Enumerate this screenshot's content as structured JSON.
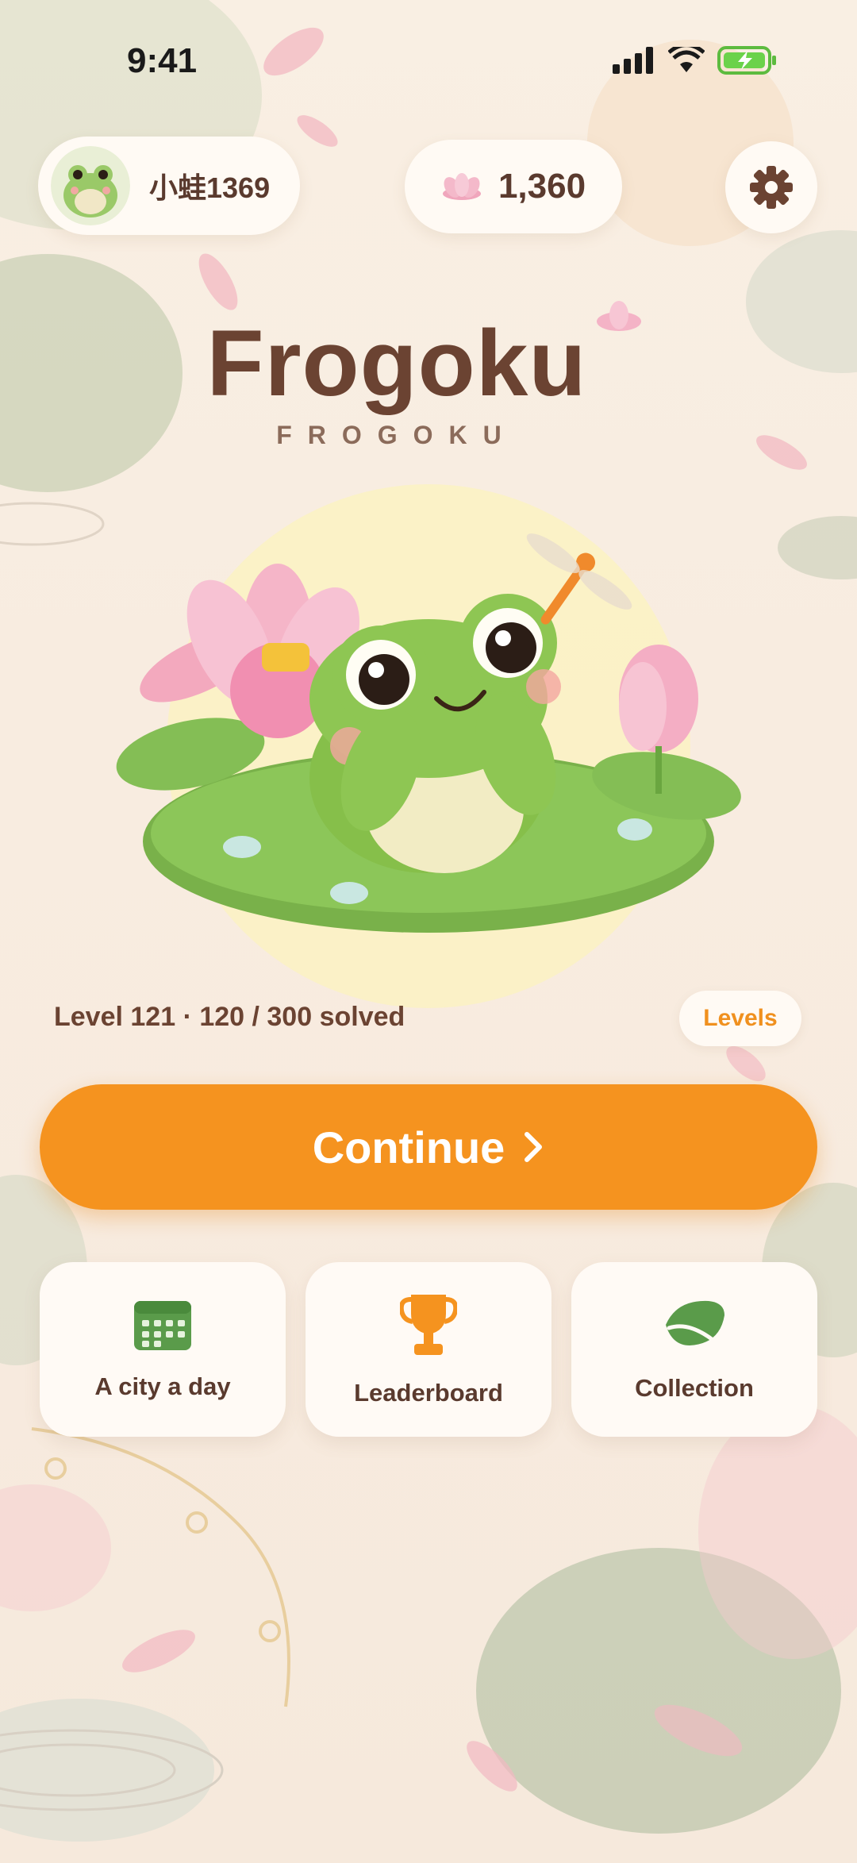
{
  "status_bar": {
    "time": "9:41"
  },
  "profile": {
    "name": "小蛙1369"
  },
  "currency": {
    "value": "1,360",
    "icon": "lotus-icon"
  },
  "settings": {
    "icon": "gear-icon"
  },
  "title": "Frogoku",
  "subtitle": "FROGOKU",
  "progress": {
    "text": "Level 121 · 120 / 300 solved",
    "solved": 120,
    "total": 300
  },
  "levels_button": "Levels",
  "continue_button": "Continue",
  "cards": [
    {
      "label": "A city a day",
      "icon": "calendar-icon"
    },
    {
      "label": "Leaderboard",
      "icon": "trophy-icon"
    },
    {
      "label": "Collection",
      "icon": "leaf-icon"
    }
  ],
  "colors": {
    "accent": "#f5931f",
    "brown": "#6b4332",
    "green": "#5a9b4a",
    "background": "#f8ece0"
  }
}
